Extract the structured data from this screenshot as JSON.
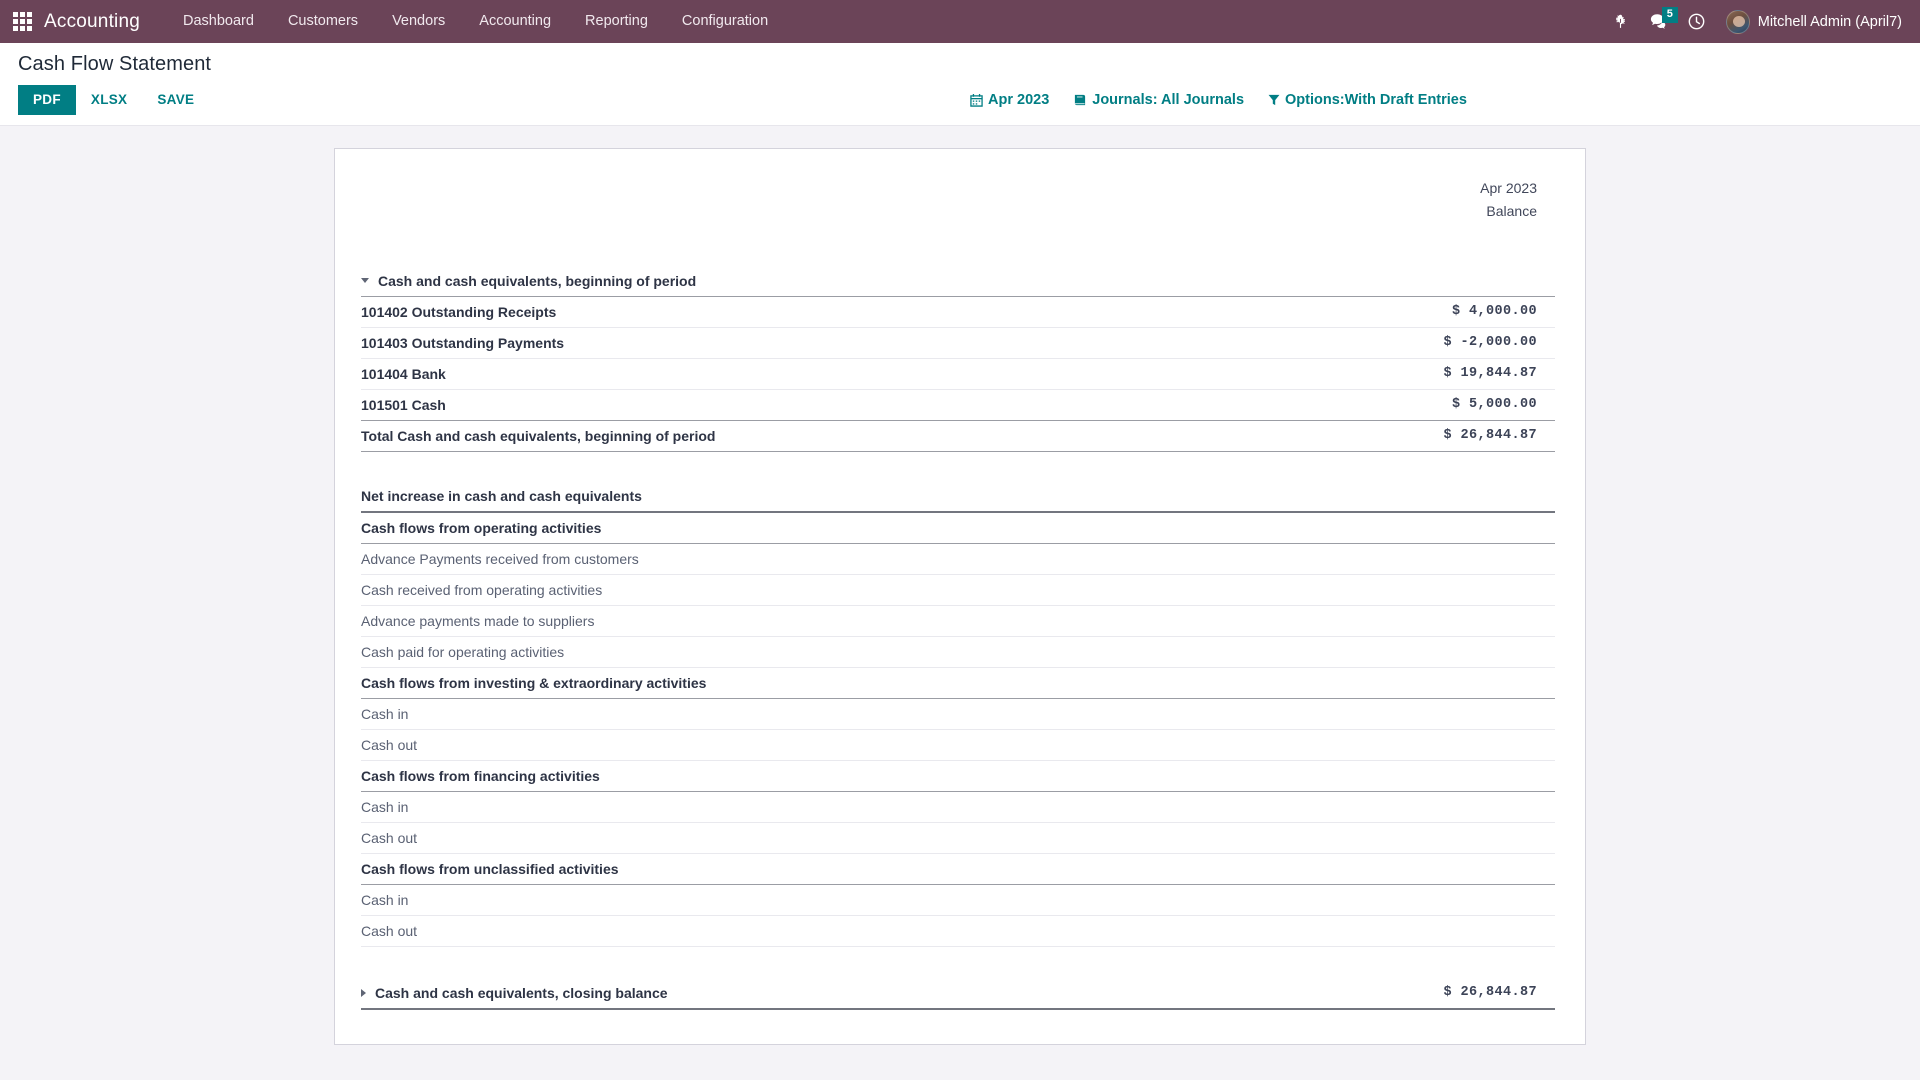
{
  "navbar": {
    "apps_icon": "apps-grid-icon",
    "brand": "Accounting",
    "menu": [
      {
        "label": "Dashboard"
      },
      {
        "label": "Customers"
      },
      {
        "label": "Vendors"
      },
      {
        "label": "Accounting"
      },
      {
        "label": "Reporting"
      },
      {
        "label": "Configuration"
      }
    ],
    "bug_icon": "bug-icon",
    "messages_icon": "chat-bubble-icon",
    "messages_count": "5",
    "activity_icon": "clock-icon",
    "avatar_icon": "user-avatar",
    "user_name": "Mitchell Admin (April7)",
    "bg_color": "#6b4458",
    "badge_color": "#017e84"
  },
  "control_panel": {
    "title": "Cash Flow Statement",
    "buttons": [
      {
        "label": "PDF",
        "style": "primary"
      },
      {
        "label": "XLSX",
        "style": "flat"
      },
      {
        "label": "SAVE",
        "style": "flat"
      }
    ],
    "filters": [
      {
        "icon": "calendar-icon",
        "label": "Apr 2023"
      },
      {
        "icon": "book-icon",
        "label": "Journals: All Journals"
      },
      {
        "icon": "funnel-icon",
        "label": "Options:With Draft Entries"
      }
    ],
    "accent_color": "#017e84"
  },
  "report": {
    "header": {
      "period": "Apr 2023",
      "column": "Balance"
    },
    "rows": [
      {
        "id": "r1",
        "label": "Cash and cash equivalents, beginning of period",
        "value": "",
        "indent": 0,
        "bold": true,
        "muted": false,
        "negative": false,
        "caret": "down",
        "border": "med"
      },
      {
        "id": "r2",
        "label": "101402 Outstanding Receipts",
        "value": "$  4,000.00",
        "indent": 1,
        "bold": true,
        "muted": false,
        "negative": false,
        "caret": "none",
        "border": "thin"
      },
      {
        "id": "r3",
        "label": "101403 Outstanding Payments",
        "value": "$ -2,000.00",
        "indent": 1,
        "bold": true,
        "muted": false,
        "negative": true,
        "caret": "none",
        "border": "thin"
      },
      {
        "id": "r4",
        "label": "101404 Bank",
        "value": "$ 19,844.87",
        "indent": 1,
        "bold": true,
        "muted": false,
        "negative": false,
        "caret": "none",
        "border": "thin"
      },
      {
        "id": "r5",
        "label": "101501 Cash",
        "value": "$  5,000.00",
        "indent": 1,
        "bold": true,
        "muted": false,
        "negative": false,
        "caret": "none",
        "border": "med"
      },
      {
        "id": "r6",
        "label": "Total Cash and cash equivalents, beginning of period",
        "value": "$ 26,844.87",
        "indent": 1,
        "bold": true,
        "muted": false,
        "negative": false,
        "caret": "none",
        "border": "med"
      },
      {
        "id": "gap1",
        "type": "gap"
      },
      {
        "id": "r7",
        "label": "Net increase in cash and cash equivalents",
        "value": "",
        "indent": 0,
        "bold": true,
        "muted": false,
        "negative": false,
        "caret": "none",
        "border": "thick"
      },
      {
        "id": "r8",
        "label": "Cash flows from operating activities",
        "value": "",
        "indent": 1,
        "bold": true,
        "muted": false,
        "negative": false,
        "caret": "none",
        "border": "med"
      },
      {
        "id": "r9",
        "label": "Advance Payments received from customers",
        "value": "",
        "indent": 2,
        "bold": false,
        "muted": true,
        "negative": false,
        "caret": "none",
        "border": "thin"
      },
      {
        "id": "r10",
        "label": "Cash received from operating activities",
        "value": "",
        "indent": 2,
        "bold": false,
        "muted": true,
        "negative": false,
        "caret": "none",
        "border": "thin"
      },
      {
        "id": "r11",
        "label": "Advance payments made to suppliers",
        "value": "",
        "indent": 2,
        "bold": false,
        "muted": true,
        "negative": false,
        "caret": "none",
        "border": "thin"
      },
      {
        "id": "r12",
        "label": "Cash paid for operating activities",
        "value": "",
        "indent": 2,
        "bold": false,
        "muted": true,
        "negative": false,
        "caret": "none",
        "border": "thin"
      },
      {
        "id": "r13",
        "label": "Cash flows from investing & extraordinary activities",
        "value": "",
        "indent": 1,
        "bold": true,
        "muted": false,
        "negative": false,
        "caret": "none",
        "border": "med"
      },
      {
        "id": "r14",
        "label": "Cash in",
        "value": "",
        "indent": 2,
        "bold": false,
        "muted": true,
        "negative": false,
        "caret": "none",
        "border": "thin"
      },
      {
        "id": "r15",
        "label": "Cash out",
        "value": "",
        "indent": 2,
        "bold": false,
        "muted": true,
        "negative": false,
        "caret": "none",
        "border": "thin"
      },
      {
        "id": "r16",
        "label": "Cash flows from financing activities",
        "value": "",
        "indent": 1,
        "bold": true,
        "muted": false,
        "negative": false,
        "caret": "none",
        "border": "med"
      },
      {
        "id": "r17",
        "label": "Cash in",
        "value": "",
        "indent": 2,
        "bold": false,
        "muted": true,
        "negative": false,
        "caret": "none",
        "border": "thin"
      },
      {
        "id": "r18",
        "label": "Cash out",
        "value": "",
        "indent": 2,
        "bold": false,
        "muted": true,
        "negative": false,
        "caret": "none",
        "border": "thin"
      },
      {
        "id": "r19",
        "label": "Cash flows from unclassified activities",
        "value": "",
        "indent": 1,
        "bold": true,
        "muted": false,
        "negative": false,
        "caret": "none",
        "border": "med"
      },
      {
        "id": "r20",
        "label": "Cash in",
        "value": "",
        "indent": 2,
        "bold": false,
        "muted": true,
        "negative": false,
        "caret": "none",
        "border": "thin"
      },
      {
        "id": "r21",
        "label": "Cash out",
        "value": "",
        "indent": 2,
        "bold": false,
        "muted": true,
        "negative": false,
        "caret": "none",
        "border": "thin"
      },
      {
        "id": "gap2",
        "type": "gap"
      },
      {
        "id": "r22",
        "label": "Cash and cash equivalents, closing balance",
        "value": "$ 26,844.87",
        "indent": 0,
        "bold": true,
        "muted": false,
        "negative": false,
        "caret": "right",
        "border": "thick"
      }
    ]
  }
}
